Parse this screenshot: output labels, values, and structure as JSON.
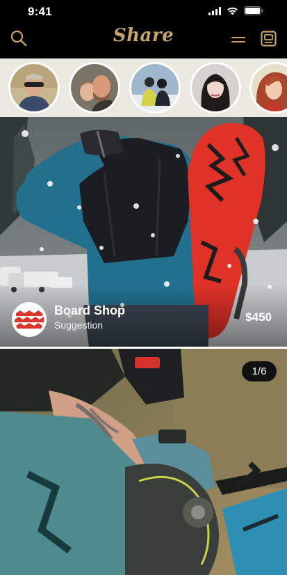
{
  "status_bar": {
    "time": "9:41"
  },
  "header": {
    "logo": "Share",
    "icons": [
      "search-icon",
      "menu-icon",
      "feed-icon"
    ],
    "accent_color": "#c9a46a"
  },
  "stories": [
    {
      "name": "story-1"
    },
    {
      "name": "story-2"
    },
    {
      "name": "story-3"
    },
    {
      "name": "story-4"
    },
    {
      "name": "story-5"
    }
  ],
  "posts": [
    {
      "shop_name": "Board Shop",
      "subtitle": "Suggestion",
      "price": "$450"
    },
    {
      "counter": "1/6"
    }
  ]
}
